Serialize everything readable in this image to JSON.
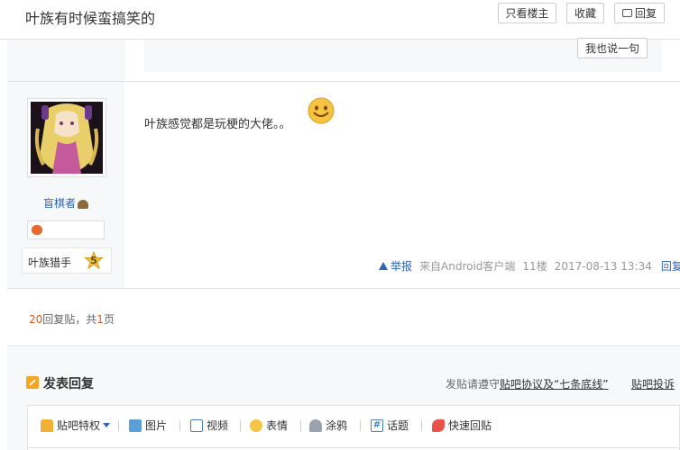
{
  "header": {
    "title": "叶族有时候蛮搞笑的",
    "only_op_label": "只看楼主",
    "collect_label": "收藏",
    "reply_label": "回复"
  },
  "upper_post": {
    "say_label": "我也说一句"
  },
  "post": {
    "username": "盲棋者",
    "level_name": "叶族猎手",
    "level": "5",
    "content": "叶族感觉都是玩梗的大佬。。",
    "report_label": "举报",
    "source": "来自Android客户端",
    "floor": "11楼",
    "time": "2017-08-13 13:34",
    "reply_label": "回复"
  },
  "pager": {
    "count": "20",
    "text1": "回复贴，共",
    "pages": "1",
    "text2": "页"
  },
  "reply_section": {
    "title": "发表回复",
    "rules_prefix": "发贴请遵守",
    "rules_link": "贴吧协议及“七条底线”",
    "complaint": "贴吧投诉",
    "toolbar": {
      "privilege": "贴吧特权",
      "image": "图片",
      "video": "视频",
      "emoji": "表情",
      "doodle": "涂鸦",
      "topic": "话题",
      "quick_reply": "快速回贴"
    }
  },
  "colors": {
    "link": "#2d64b3",
    "accent": "#e65a14",
    "side_bg": "#f7f8fa"
  }
}
